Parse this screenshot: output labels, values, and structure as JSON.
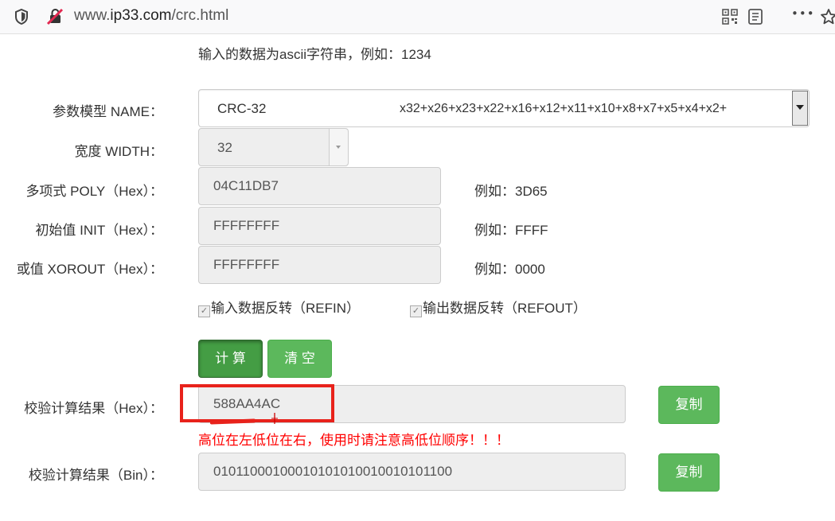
{
  "browser": {
    "url_prefix": "www.",
    "url_domain": "ip33.com",
    "url_path": "/crc.html",
    "more_label": "•••"
  },
  "intro_text": "输入的数据为ascii字符串，例如：1234",
  "name": {
    "label": "参数模型 NAME：",
    "value": "CRC-32",
    "poly_formula": "x32+x26+x23+x22+x16+x12+x11+x10+x8+x7+x5+x4+x2+"
  },
  "width": {
    "label": "宽度 WIDTH：",
    "value": "32"
  },
  "poly": {
    "label": "多项式 POLY（Hex）：",
    "value": "04C11DB7",
    "example": "例如：3D65"
  },
  "init": {
    "label": "初始值 INIT（Hex）：",
    "value": "FFFFFFFF",
    "example": "例如：FFFF"
  },
  "xorout": {
    "label": "或值 XOROUT（Hex）：",
    "value": "FFFFFFFF",
    "example": "例如：0000"
  },
  "refin_label": "输入数据反转（REFIN）",
  "refout_label": "输出数据反转（REFOUT）",
  "buttons": {
    "calculate": "计 算",
    "clear": "清 空",
    "copy": "复制"
  },
  "result_hex": {
    "label": "校验计算结果（Hex）：",
    "value": "588AA4AC",
    "warning": "高位在左低位在右，使用时请注意高低位顺序！！！"
  },
  "result_bin": {
    "label": "校验计算结果（Bin）：",
    "value": "01011000100010101010010010101100"
  },
  "colors": {
    "warning": "#ff0000",
    "highlight_box": "#e8221b",
    "button_green": "#5cb85c"
  }
}
